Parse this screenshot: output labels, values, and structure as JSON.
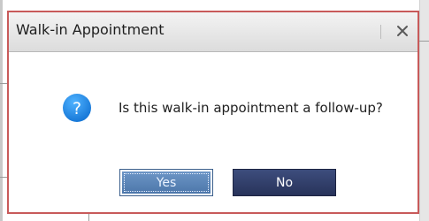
{
  "dialog": {
    "title": "Walk-in Appointment",
    "message": "Is this walk-in appointment a follow-up?",
    "icon": "question-icon",
    "yes_label": "Yes",
    "no_label": "No",
    "close_icon": "close-icon"
  },
  "colors": {
    "icon_blue": "#1e88e5",
    "yes_button": "#5a84b8",
    "no_button": "#2f3b66",
    "dialog_border": "#c85a5a"
  }
}
